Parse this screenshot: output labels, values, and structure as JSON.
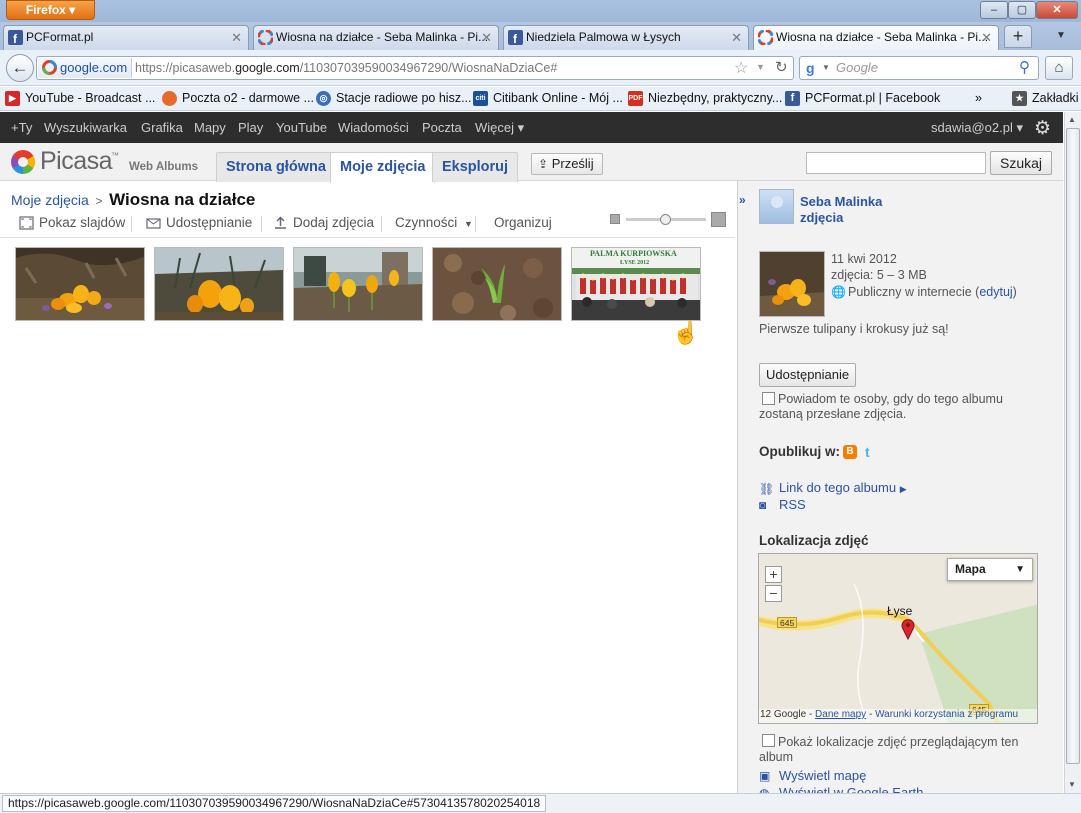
{
  "browser": {
    "menu_button": "Firefox",
    "tabs": [
      {
        "title": "PCFormat.pl",
        "icon": "facebook-icon"
      },
      {
        "title": "Wiosna na działce - Seba Malinka - Pi...",
        "icon": "picasa-icon"
      },
      {
        "title": "Niedziela Palmowa w Łysych",
        "icon": "facebook-icon"
      },
      {
        "title": "Wiosna na działce - Seba Malinka - Pi...",
        "icon": "picasa-icon"
      }
    ],
    "url_identity": "google.com",
    "url_prefix": "https://picasaweb.",
    "url_domain": "google.com",
    "url_path": "/110307039590034967290/WiosnaNaDziaCe#",
    "search_placeholder": "Google",
    "bookmarks": [
      {
        "label": "YouTube - Broadcast ...",
        "icon": "youtube-icon",
        "color": "#d62828"
      },
      {
        "label": "Poczta o2 - darmowe ...",
        "icon": "balloon-icon",
        "color": "#e56b2c"
      },
      {
        "label": "Stacje radiowe po hisz...",
        "icon": "radio-icon",
        "color": "#3a6fb7"
      },
      {
        "label": "Citibank Online - Mój ...",
        "icon": "citi-icon",
        "color": "#1b4f9a"
      },
      {
        "label": "Niezbędny, praktyczny...",
        "icon": "pdf-icon",
        "color": "#d42f1f"
      },
      {
        "label": "PCFormat.pl | Facebook",
        "icon": "facebook-icon",
        "color": "#3b5998"
      }
    ],
    "bookmarks_overflow": "»",
    "bookmarks_menu": "Zakładki",
    "status_url": "https://picasaweb.google.com/110307039590034967290/WiosnaNaDziaCe#5730413578020254018"
  },
  "gbar": {
    "items": [
      "+Ty",
      "Wyszukiwarka",
      "Grafika",
      "Mapy",
      "Play",
      "YouTube",
      "Wiadomości",
      "Poczta",
      "Więcej ▾"
    ],
    "account": "sdawia@o2.pl ▾"
  },
  "picasa": {
    "logo": "Picasa",
    "logo_tm": "™",
    "logo_sub": "Web Albums",
    "tabs": [
      "Strona główna",
      "Moje zdjęcia",
      "Eksploruj"
    ],
    "active_tab": "Moje zdjęcia",
    "upload_label": "Prześlij",
    "search_button": "Szukaj"
  },
  "album": {
    "breadcrumb_link": "Moje zdjęcia",
    "breadcrumb_sep": ">",
    "title": "Wiosna na działce",
    "toolbar": {
      "slideshow": "Pokaz slajdów",
      "share": "Udostępnianie",
      "add_photos": "Dodaj zdjęcia",
      "actions": "Czynności",
      "organize": "Organizuj"
    },
    "photos": [
      {
        "subject": "yellow crocuses"
      },
      {
        "subject": "yellow crocuses close-up"
      },
      {
        "subject": "crocuses in garden"
      },
      {
        "subject": "green tulip shoot"
      },
      {
        "subject": "choir on stage"
      }
    ],
    "banner_text_1": "PALMA KURPIOWSKA",
    "banner_text_2": "ŁYSE 2012"
  },
  "sidebar": {
    "owner_name": "Seba Malinka",
    "owner_photos": "zdjęcia",
    "date": "11 kwi 2012",
    "photos_count": "zdjęcia: 5 – 3 MB",
    "visibility": "Publiczny w internecie (",
    "edit_link": "edytuj",
    "visibility_end": ")",
    "description": "Pierwsze tulipany i krokusy już są!",
    "share_button": "Udostępnianie",
    "notify_line1": "Powiadom te osoby, gdy do tego albumu",
    "notify_line2": "zostaną przesłane zdjęcia.",
    "publish_label": "Opublikuj w:",
    "album_link": "Link do tego albumu",
    "rss": "RSS",
    "location_heading": "Lokalizacja zdjęć",
    "map": {
      "type_button": "Mapa",
      "zoom_in": "+",
      "zoom_out": "−",
      "town": "Łyse",
      "road_labels": [
        "645",
        "645"
      ],
      "copyright": "12 Google - ",
      "map_data": "Dane mapy",
      "dash": " - ",
      "terms": "Warunki korzystania z programu"
    },
    "show_location_line1": "Pokaż lokalizacje zdjęć przeglądającym ten",
    "show_location_line2": "album",
    "view_map": "Wyświetl mapę",
    "view_earth": "Wyświetl w Google Earth"
  }
}
